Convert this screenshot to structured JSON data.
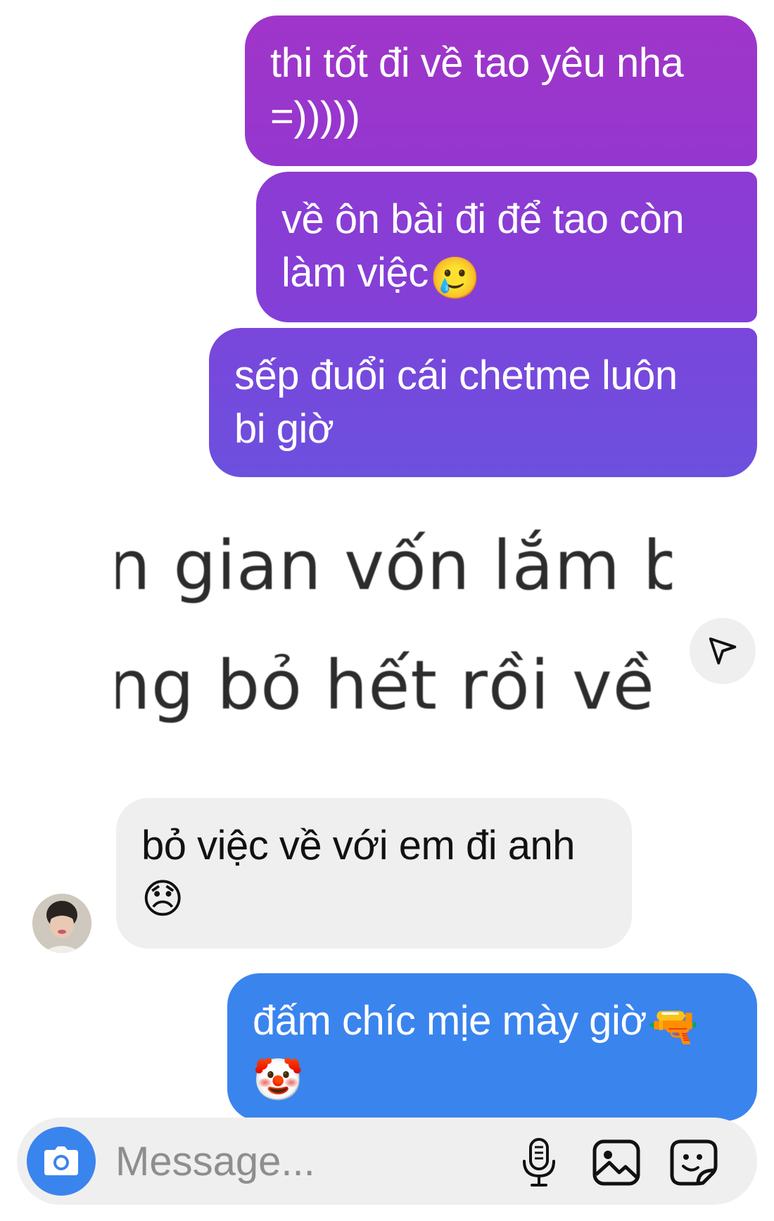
{
  "thread": {
    "messages": [
      {
        "sender": "me",
        "lines": [
          "thi tốt đi về tao yêu nha",
          "=)))))"
        ]
      },
      {
        "sender": "me",
        "lines": [
          "về ôn bài đi để tao còn",
          "làm việc"
        ],
        "emoji": "🥲"
      },
      {
        "sender": "me",
        "lines": [
          "sếp đuổi cái chetme luôn",
          "bi giờ"
        ]
      },
      {
        "sender": "other",
        "shared_image": {
          "lines": [
            "n gian vốn lắm bộ",
            "ng bỏ hết rồi về b"
          ]
        }
      },
      {
        "sender": "other",
        "lines": [
          "bỏ việc về với em đi anh",
          ""
        ],
        "emoji": "😞"
      },
      {
        "sender": "me",
        "lines": [
          "đấm chíc mịe mày giờ",
          ""
        ],
        "emoji": "🔫",
        "emoji2": "🤡"
      }
    ]
  },
  "composer": {
    "placeholder": "Message...",
    "icons": {
      "camera": "camera-icon",
      "mic": "microphone-icon",
      "gallery": "image-icon",
      "sticker": "sticker-icon"
    }
  },
  "icons": {
    "share": "send-icon"
  },
  "colors": {
    "bubble_purple_top": "#a035c9",
    "bubble_purple_bottom": "#6c50de",
    "bubble_blue": "#3a84ee",
    "bubble_gray": "#efefef",
    "camera_blue": "#3a84ee"
  }
}
